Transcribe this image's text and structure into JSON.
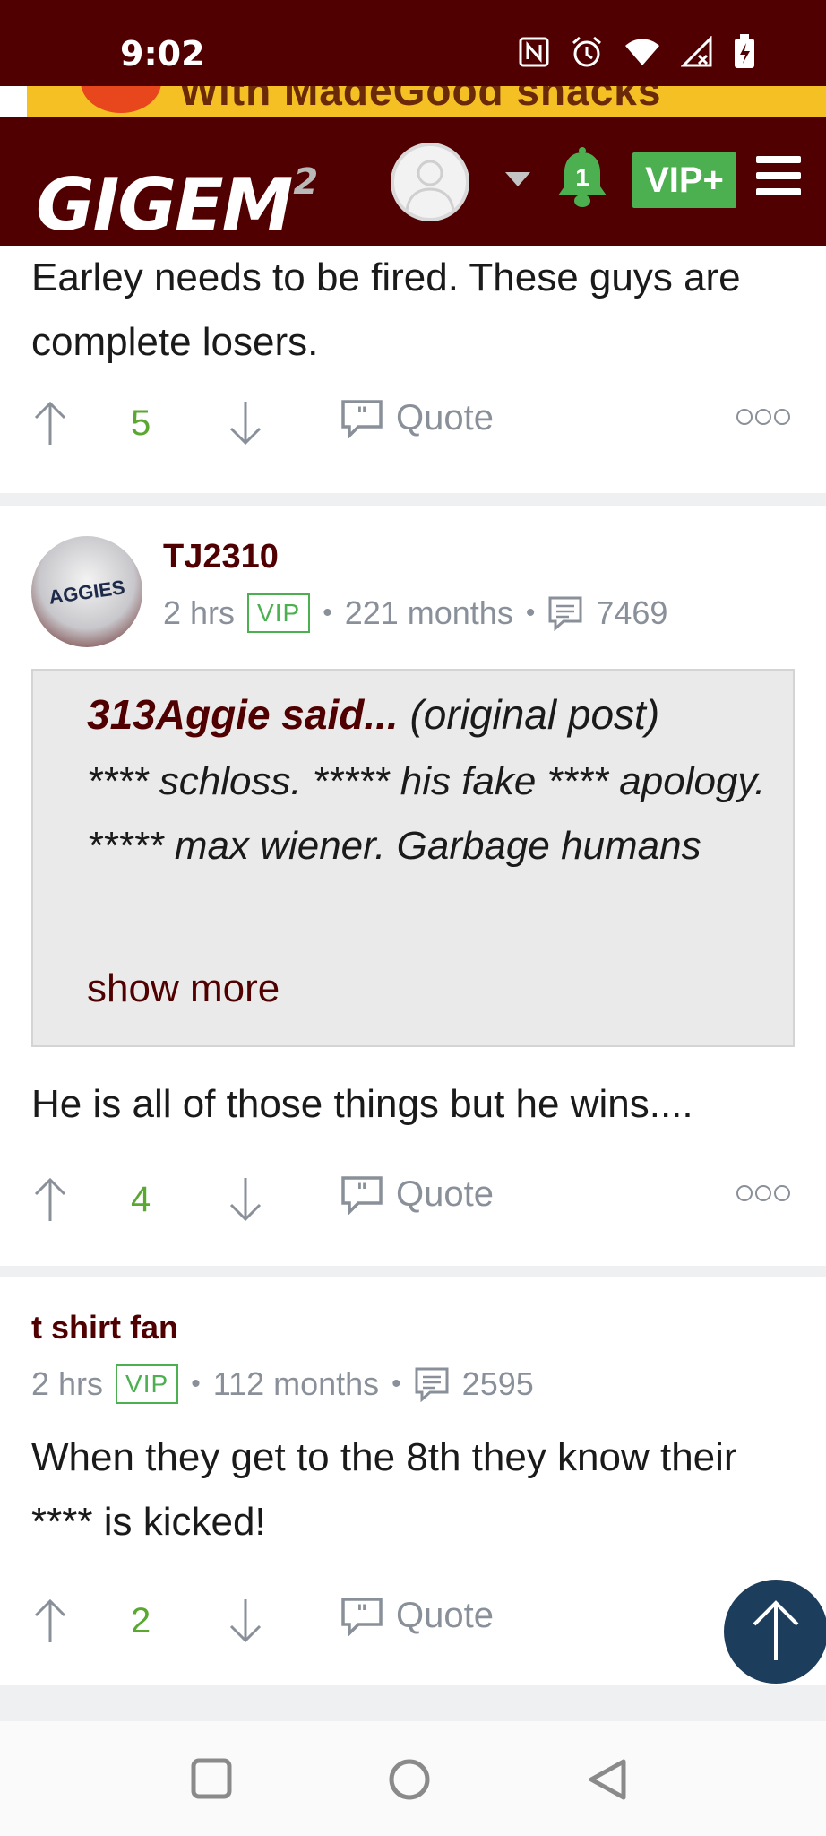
{
  "status_bar": {
    "time": "9:02",
    "icons": [
      "nfc-icon",
      "alarm-icon",
      "wifi-icon",
      "no-signal-icon",
      "battery-charging-icon"
    ]
  },
  "ad": {
    "text": "With MadeGood snacks"
  },
  "navbar": {
    "logo_text": "GIGEM",
    "logo_superscript": "2",
    "notification_count": "1",
    "vip_label": "VIP+",
    "colors": {
      "brand": "#500000",
      "accent_green": "#4caf50"
    }
  },
  "posts": [
    {
      "body": "Earley needs to be fired. These guys are complete losers.",
      "votes": "5",
      "quote_label": "Quote"
    },
    {
      "username": "TJ2310",
      "time": "2 hrs",
      "badge": "VIP",
      "tenure": "221 months",
      "post_count": "7469",
      "quoted": {
        "author": "313Aggie said...",
        "source": "(original post)",
        "text": "**** schloss. ***** his fake **** apology. ***** max wiener. Garbage humans",
        "show_more": "show more"
      },
      "body": "He is all of those things but he wins....",
      "votes": "4",
      "quote_label": "Quote"
    },
    {
      "username": "t shirt fan",
      "time": "2 hrs",
      "badge": "VIP",
      "tenure": "112 months",
      "post_count": "2595",
      "body": "When they get to the 8th they know their **** is kicked!",
      "votes": "2",
      "quote_label": "Quote"
    }
  ],
  "separator": "•"
}
